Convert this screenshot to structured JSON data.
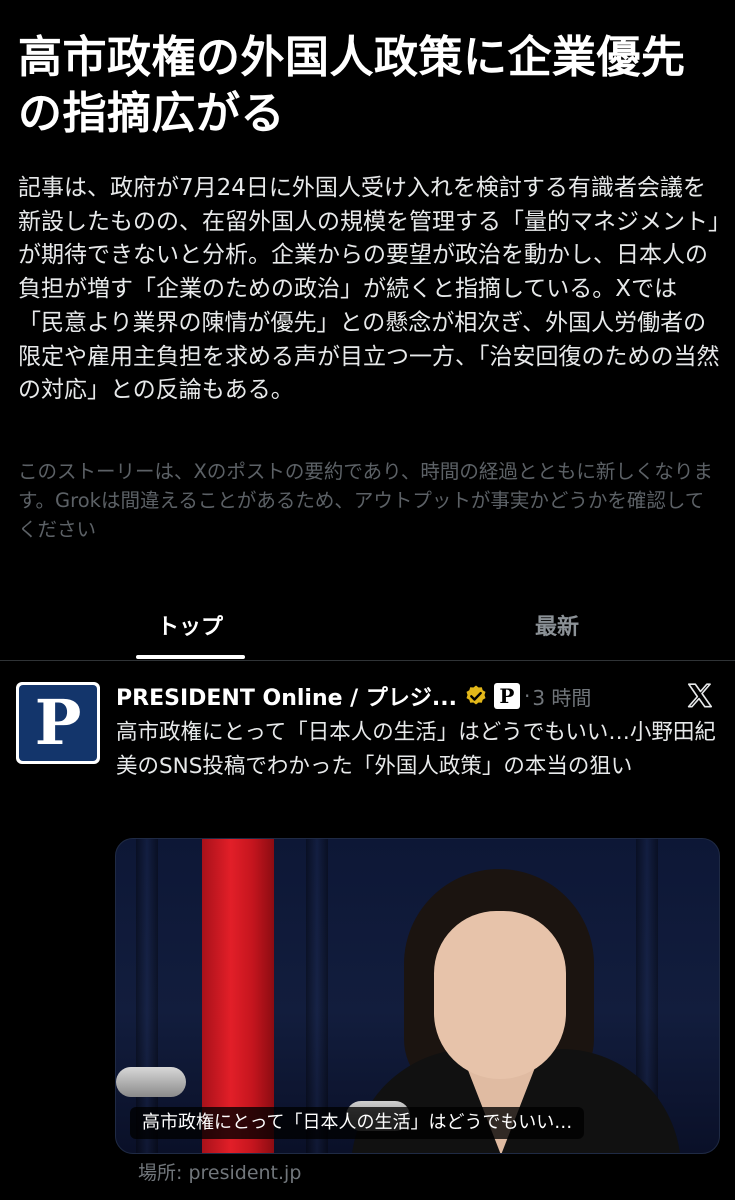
{
  "headline": "高市政権の外国人政策に企業優先の指摘広がる",
  "summary": "記事は、政府が7月24日に外国人受け入れを検討する有識者会議を新設したものの、在留外国人の規模を管理する「量的マネジメント」が期待できないと分析。企業からの要望が政治を動かし、日本人の負担が増す「企業のための政治」が続くと指摘している。Xでは「民意より業界の陳情が優先」との懸念が相次ぎ、外国人労働者の限定や雇用主負担を求める声が目立つ一方、「治安回復のための当然の対応」との反論もある。",
  "disclaimer": "このストーリーは、Xのポストの要約であり、時間の経過とともに新しくなります。Grokは間違えることがあるため、アウトプットが事実かどうかを確認してください",
  "tabs": [
    {
      "label": "トップ",
      "active": true
    },
    {
      "label": "最新",
      "active": false
    }
  ],
  "post": {
    "avatar_letter": "P",
    "author": "PRESIDENT Online / プレジ...",
    "badge_letter": "P",
    "separator": "·",
    "time": "3 時間",
    "text": "高市政権にとって「日本人の生活」はどうでもいい…小野田紀美のSNS投稿でわかった「外国人政策」の本当の狙い",
    "media_caption": "高市政権にとって「日本人の生活」はどうでもいい…",
    "source": "場所: president.jp",
    "verified_color": "#e2b719",
    "avatar_color": "#13356b"
  }
}
